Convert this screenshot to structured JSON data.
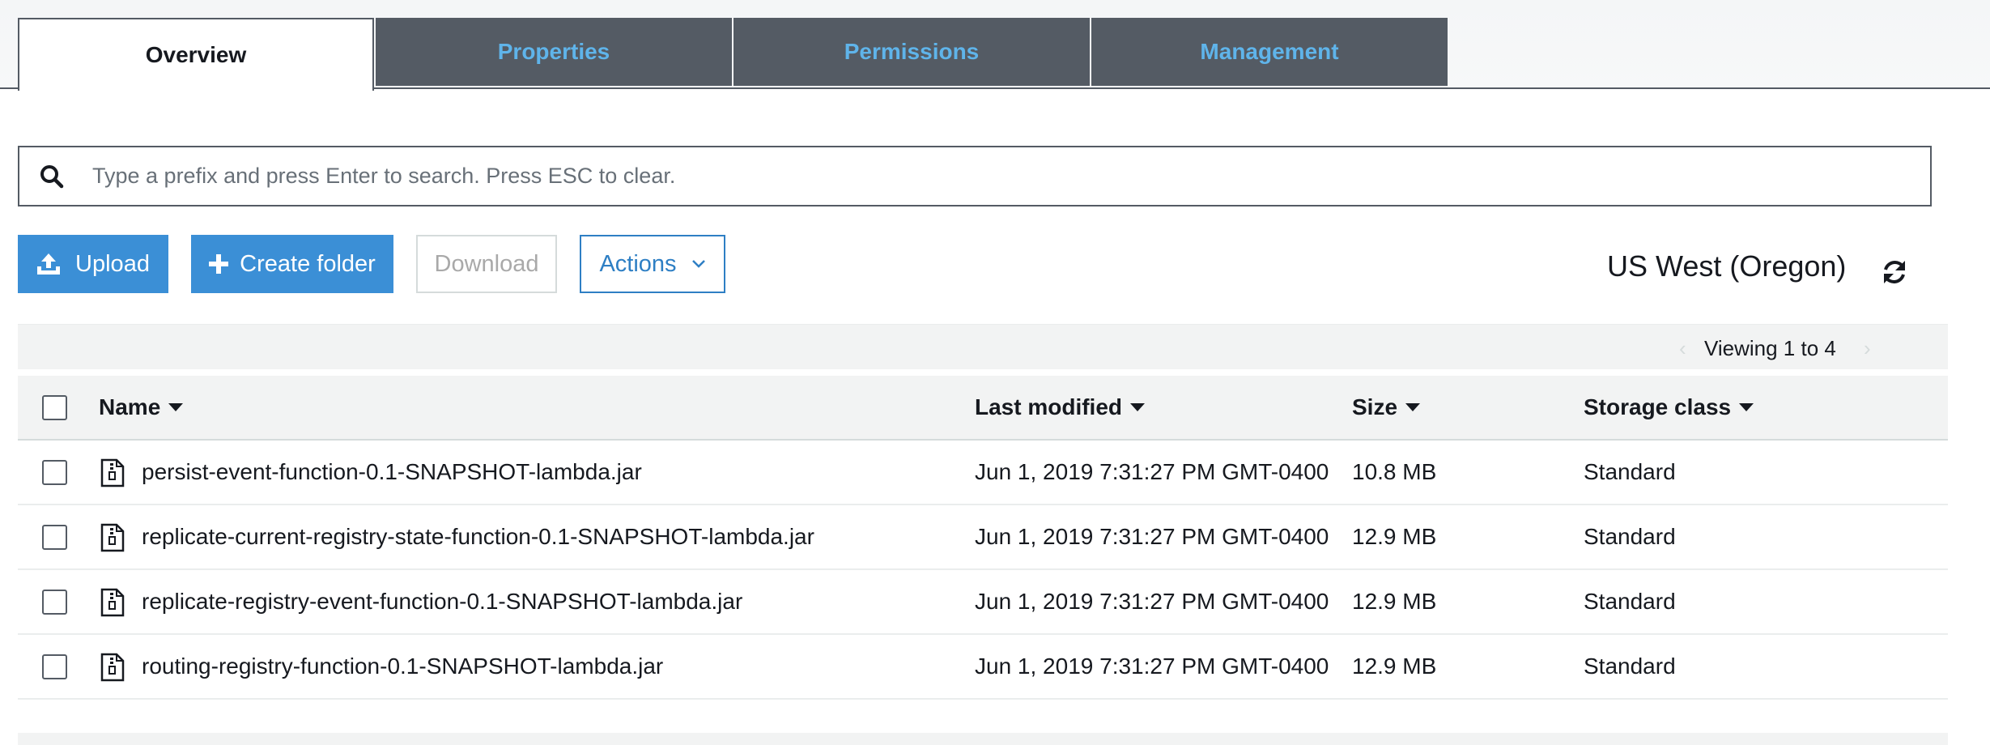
{
  "tabs": [
    {
      "label": "Overview",
      "active": true
    },
    {
      "label": "Properties",
      "active": false
    },
    {
      "label": "Permissions",
      "active": false
    },
    {
      "label": "Management",
      "active": false
    }
  ],
  "search": {
    "placeholder": "Type a prefix and press Enter to search. Press ESC to clear.",
    "value": "",
    "icon": "search-icon"
  },
  "toolbar": {
    "upload_label": "Upload",
    "create_folder_label": "Create folder",
    "download_label": "Download",
    "actions_label": "Actions"
  },
  "region": "US West (Oregon)",
  "pagination": {
    "label": "Viewing 1 to 4",
    "prev": "‹",
    "next": "›"
  },
  "table": {
    "columns": {
      "name": "Name",
      "last_modified": "Last modified",
      "size": "Size",
      "storage_class": "Storage class"
    },
    "rows": [
      {
        "name": "persist-event-function-0.1-SNAPSHOT-lambda.jar",
        "last_modified": "Jun 1, 2019 7:31:27 PM GMT-0400",
        "size": "10.8 MB",
        "storage_class": "Standard"
      },
      {
        "name": "replicate-current-registry-state-function-0.1-SNAPSHOT-lambda.jar",
        "last_modified": "Jun 1, 2019 7:31:27 PM GMT-0400",
        "size": "12.9 MB",
        "storage_class": "Standard"
      },
      {
        "name": "replicate-registry-event-function-0.1-SNAPSHOT-lambda.jar",
        "last_modified": "Jun 1, 2019 7:31:27 PM GMT-0400",
        "size": "12.9 MB",
        "storage_class": "Standard"
      },
      {
        "name": "routing-registry-function-0.1-SNAPSHOT-lambda.jar",
        "last_modified": "Jun 1, 2019 7:31:27 PM GMT-0400",
        "size": "12.9 MB",
        "storage_class": "Standard"
      }
    ]
  },
  "colors": {
    "tab_inactive_bg": "#545b64",
    "tab_inactive_text": "#5fb4ea",
    "primary_button": "#3b8fd6",
    "outline_button": "#2e7fc4",
    "header_bg": "#f2f3f3"
  }
}
